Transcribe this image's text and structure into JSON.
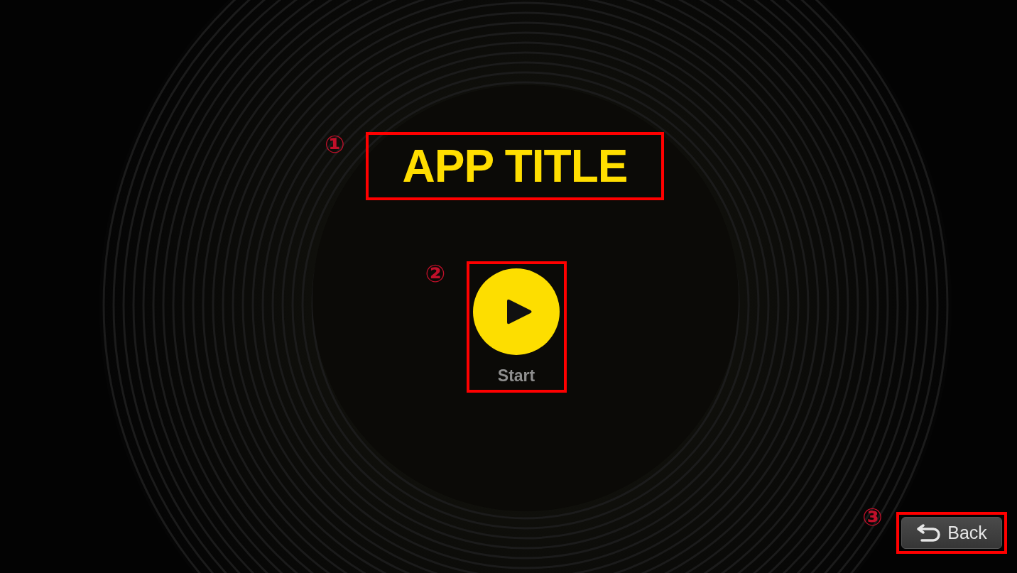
{
  "title": {
    "text": "APP TITLE",
    "marker": "①"
  },
  "start": {
    "label": "Start",
    "marker": "②"
  },
  "back": {
    "label": "Back",
    "marker": "③"
  }
}
